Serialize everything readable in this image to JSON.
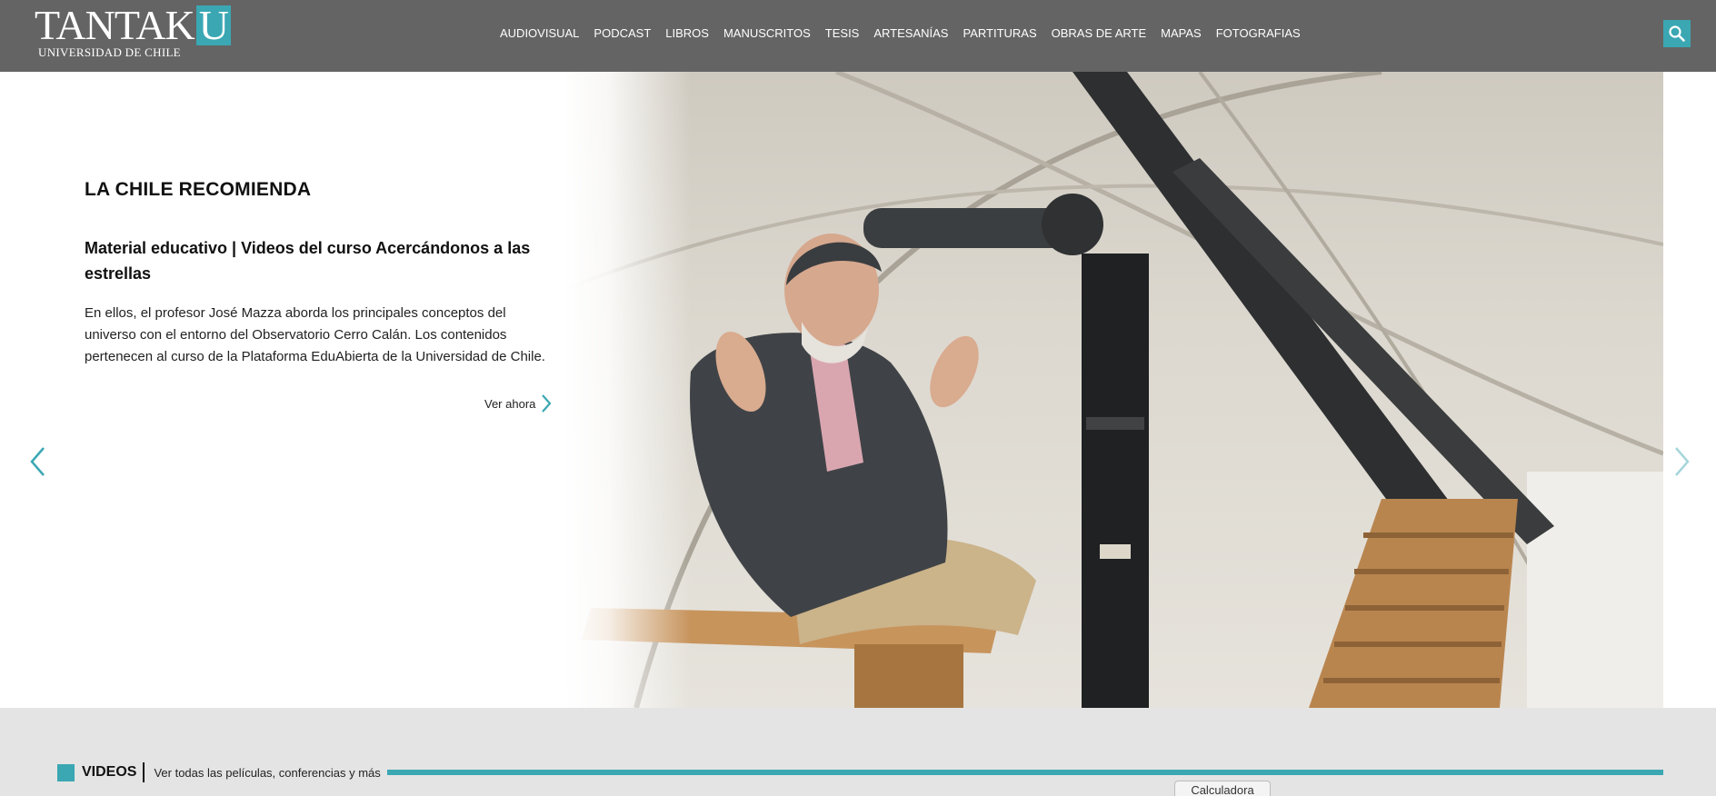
{
  "header": {
    "logo_text": "TANTAK",
    "logo_accent": "U",
    "logo_subtitle": "UNIVERSIDAD DE CHILE",
    "nav": [
      "AUDIOVISUAL",
      "PODCAST",
      "LIBROS",
      "MANUSCRITOS",
      "TESIS",
      "ARTESANÍAS",
      "PARTITURAS",
      "OBRAS DE ARTE",
      "MAPAS",
      "FOTOGRAFIAS"
    ],
    "search_icon": "search-icon"
  },
  "hero": {
    "heading": "LA CHILE RECOMIENDA",
    "title": "Material educativo | Videos del curso Acercándonos a las estrellas",
    "body": "En ellos, el profesor José Mazza aborda los principales conceptos del universo con el entorno del Observatorio Cerro Calán. Los contenidos pertenecen al curso de la Plataforma EduAbierta de la Universidad de Chile.",
    "cta_label": "Ver ahora"
  },
  "section": {
    "title": "VIDEOS",
    "subtitle": "Ver todas las películas, conferencias y más"
  },
  "overlay": {
    "calc_label": "Calculadora"
  },
  "colors": {
    "accent": "#3aa7b3",
    "header_bg": "#646464",
    "section_bg": "#e4e4e4"
  }
}
